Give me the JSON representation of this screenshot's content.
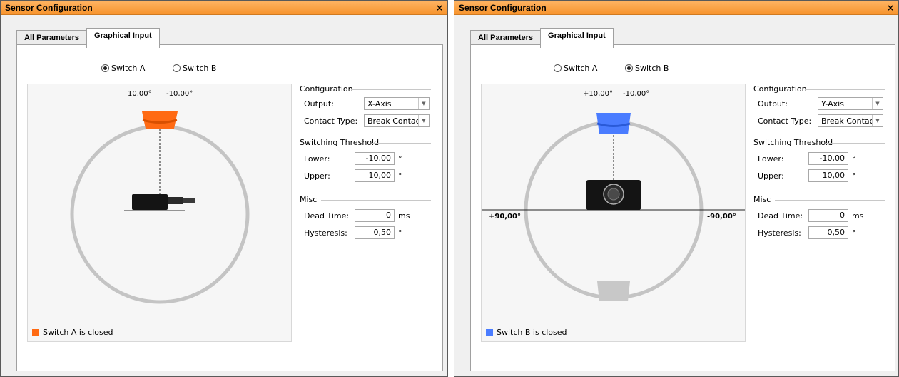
{
  "windows": [
    {
      "title": "Sensor Configuration",
      "close": "×",
      "tabs": [
        {
          "label": "All Parameters",
          "active": false
        },
        {
          "label": "Graphical Input",
          "active": true
        }
      ],
      "switches": [
        {
          "label": "Switch A",
          "selected": true
        },
        {
          "label": "Switch B",
          "selected": false
        }
      ],
      "graphic": {
        "view": "side",
        "marker_color": "#ff6a13",
        "threshold_label_left": "10,00°",
        "threshold_label_right": "-10,00°",
        "horizon_left": "",
        "horizon_right": ""
      },
      "legend": {
        "color": "#ff6a13",
        "text": "Switch A is closed"
      },
      "config": {
        "configuration_title": "Configuration",
        "output_label": "Output:",
        "output_value": "X-Axis",
        "contact_label": "Contact Type:",
        "contact_value": "Break Contact",
        "threshold_title": "Switching Threshold",
        "lower_label": "Lower:",
        "lower_value": "-10,00",
        "lower_unit": "°",
        "upper_label": "Upper:",
        "upper_value": "10,00",
        "upper_unit": "°",
        "misc_title": "Misc",
        "dead_label": "Dead Time:",
        "dead_value": "0",
        "dead_unit": "ms",
        "hyst_label": "Hysteresis:",
        "hyst_value": "0,50",
        "hyst_unit": "°"
      }
    },
    {
      "title": "Sensor Configuration",
      "close": "×",
      "tabs": [
        {
          "label": "All Parameters",
          "active": false
        },
        {
          "label": "Graphical Input",
          "active": true
        }
      ],
      "switches": [
        {
          "label": "Switch A",
          "selected": false
        },
        {
          "label": "Switch B",
          "selected": true
        }
      ],
      "graphic": {
        "view": "front",
        "marker_color": "#4a7cff",
        "threshold_label_left": "+10,00°",
        "threshold_label_right": "-10,00°",
        "horizon_left": "+90,00°",
        "horizon_right": "-90,00°"
      },
      "legend": {
        "color": "#4a7cff",
        "text": "Switch B is closed"
      },
      "config": {
        "configuration_title": "Configuration",
        "output_label": "Output:",
        "output_value": "Y-Axis",
        "contact_label": "Contact Type:",
        "contact_value": "Break Contact",
        "threshold_title": "Switching Threshold",
        "lower_label": "Lower:",
        "lower_value": "-10,00",
        "lower_unit": "°",
        "upper_label": "Upper:",
        "upper_value": "10,00",
        "upper_unit": "°",
        "misc_title": "Misc",
        "dead_label": "Dead Time:",
        "dead_value": "0",
        "dead_unit": "ms",
        "hyst_label": "Hysteresis:",
        "hyst_value": "0,50",
        "hyst_unit": "°"
      }
    }
  ]
}
